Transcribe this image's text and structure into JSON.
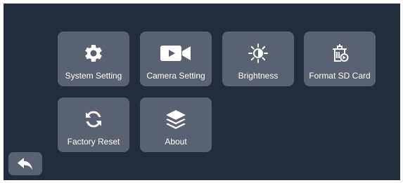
{
  "menu": {
    "items": [
      {
        "label": "System Setting",
        "icon": "gear-icon"
      },
      {
        "label": "Camera Setting",
        "icon": "video-camera-icon"
      },
      {
        "label": "Brightness",
        "icon": "brightness-icon"
      },
      {
        "label": "Format SD Card",
        "icon": "format-sd-card-icon"
      },
      {
        "label": "Factory Reset",
        "icon": "refresh-icon"
      },
      {
        "label": "About",
        "icon": "layers-icon"
      }
    ]
  },
  "back": {
    "icon": "back-arrow-icon"
  },
  "colors": {
    "background": "#232c3d",
    "tile": "#5a6170",
    "text": "#ffffff"
  }
}
